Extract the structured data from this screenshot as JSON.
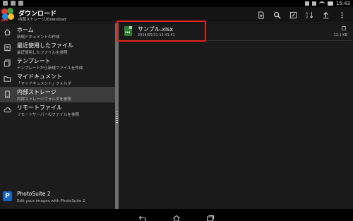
{
  "status_bar": {
    "notification_icons": [
      "notification-icon",
      "notification-icon",
      "notification-icon"
    ],
    "clock": "15:43",
    "icons": [
      "bluetooth-icon",
      "signal-icon",
      "wifi-icon",
      "battery-icon"
    ]
  },
  "action_bar": {
    "title": "ダウンロード",
    "subtitle": "内部ストレージ/Download",
    "logo_badge": "pro",
    "tools": [
      "new-file-icon",
      "search-icon",
      "edit-icon",
      "sort-icon",
      "upload-icon",
      "overflow-icon"
    ]
  },
  "sidebar": {
    "items": [
      {
        "icon": "home-icon",
        "title": "ホーム",
        "desc": "新規ドキュメントの作成"
      },
      {
        "icon": "recent-files-icon",
        "title": "最近使用したファイル",
        "desc": "最近使用したファイルを参照"
      },
      {
        "icon": "template-icon",
        "title": "テンプレート",
        "desc": "テンプレートから新規ファイルを作成"
      },
      {
        "icon": "my-documents-icon",
        "title": "マイドキュメント",
        "desc": "「マイドキュメント」フォルダ"
      },
      {
        "icon": "internal-storage-icon",
        "title": "内部ストレージ",
        "desc": "内部ストレージフォルダを参照",
        "active": true
      },
      {
        "icon": "cloud-icon",
        "title": "リモートファイル",
        "desc": "リモートサーバーのファイルを参照"
      }
    ],
    "promo": {
      "icon_letter": "P",
      "title": "PhotoSuite 2",
      "desc": "Edit your images with PhotoSuite 2"
    }
  },
  "files": [
    {
      "name": "サンプル.xlsx",
      "date": "2014/05/21 15:41:41",
      "size": "12.1 KB",
      "icon_label": "XLS",
      "icon": "excel-file-icon"
    }
  ],
  "colors": {
    "highlight": "#e0241a",
    "active_item": "#3c3c3c",
    "excel_green": "#2e7d32"
  },
  "navigation_bar": [
    "back-icon",
    "home-icon",
    "recent-apps-icon"
  ]
}
